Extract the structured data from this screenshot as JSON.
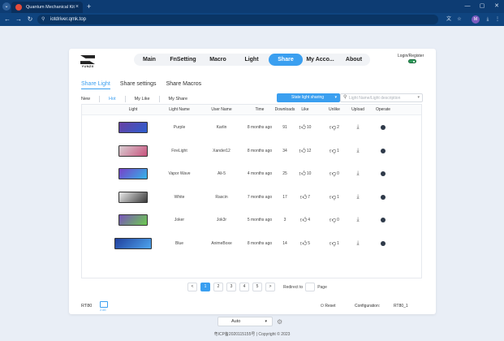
{
  "browser": {
    "tab_title": "Quantum Mechanical Kit",
    "url": "iotdriver.qmk.top",
    "profile_initial": "M"
  },
  "header": {
    "logo_text": "YUNZII",
    "nav": [
      {
        "label": "Main"
      },
      {
        "label": "FnSetting"
      },
      {
        "label": "Macro"
      },
      {
        "label": "Light"
      },
      {
        "label": "Share",
        "active": true
      },
      {
        "label": "My Acco..."
      },
      {
        "label": "About"
      }
    ],
    "login_label": "Login/Register"
  },
  "subtabs": [
    {
      "label": "Share Light",
      "active": true
    },
    {
      "label": "Share settings"
    },
    {
      "label": "Share Macros"
    }
  ],
  "filters": [
    {
      "label": "New"
    },
    {
      "label": "Hot",
      "active": true
    },
    {
      "label": "My Like"
    },
    {
      "label": "My Share"
    }
  ],
  "state_button": "State light sharing",
  "search_placeholder": "Light Name/Light description",
  "table": {
    "headers": [
      "Light",
      "Light Name",
      "User Name",
      "Time",
      "Downloads",
      "Like",
      "Unlike",
      "Upload",
      "Operate"
    ],
    "rows": [
      {
        "name": "Purple",
        "user": "Karlin",
        "time": "8 months ago",
        "downloads": "91",
        "likes": "10",
        "unlikes": "2",
        "keyboard_color": "#6b3fa0",
        "keyboard_accent": "#2a5fd0"
      },
      {
        "name": "FireLight",
        "user": "Xander12",
        "time": "8 months ago",
        "downloads": "34",
        "likes": "12",
        "unlikes": "1",
        "keyboard_color": "#d9d4d6",
        "keyboard_accent": "#c84e7a"
      },
      {
        "name": "Vapor Wave",
        "user": "Ali-5",
        "time": "4 months ago",
        "downloads": "25",
        "likes": "10",
        "unlikes": "0",
        "keyboard_color": "#7a3cc8",
        "keyboard_accent": "#30b8e8"
      },
      {
        "name": "White",
        "user": "Rascin",
        "time": "7 months ago",
        "downloads": "17",
        "likes": "7",
        "unlikes": "1",
        "keyboard_color": "#f2f2f2",
        "keyboard_accent": "#333333"
      },
      {
        "name": "Joker",
        "user": "Jok3r",
        "time": "5 months ago",
        "downloads": "3",
        "likes": "4",
        "unlikes": "0",
        "keyboard_color": "#7a4fc0",
        "keyboard_accent": "#6bd04a"
      },
      {
        "name": "Blue",
        "user": "AnimeBoxe",
        "time": "8 months ago",
        "downloads": "14",
        "likes": "5",
        "unlikes": "1",
        "keyboard_color": "#1f3c9a",
        "keyboard_accent": "#4fa8f0"
      }
    ]
  },
  "pagination": {
    "prev": "<",
    "pages": [
      "1",
      "2",
      "3",
      "4",
      "5"
    ],
    "active_page": "1",
    "next": ">",
    "redirect_label": "Redirect to",
    "page_label": "Page"
  },
  "footer": {
    "model": "RT80",
    "wireless_label": "2.4G",
    "reset_label": "Reset",
    "configuration_label": "Configuration:",
    "configuration_value": "RT80_1"
  },
  "bottom": {
    "auto_label": "Auto",
    "copyright": "粤ICP备2020115155号 | Copyright © 2023"
  },
  "colors": {
    "accent": "#3a9ff0",
    "chrome_dark": "#0d3c73"
  }
}
